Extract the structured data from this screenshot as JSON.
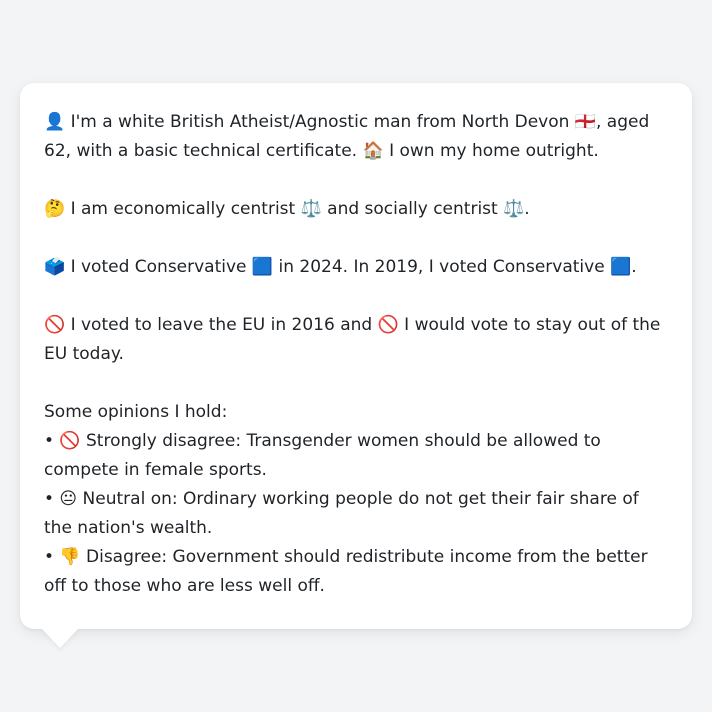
{
  "profile": {
    "line1": "👤 I'm a white British Atheist/Agnostic man from North Devon 🏴󠁧󠁢󠁥󠁮󠁧󠁿, aged 62, with a basic technical certificate. 🏠 I own my home outright.",
    "line2": "🤔 I am economically centrist ⚖️ and socially centrist ⚖️.",
    "line3": "🗳️ I voted Conservative 🟦 in 2024. In 2019, I voted Conservative 🟦.",
    "line4": "🚫 I voted to leave the EU in 2016 and 🚫 I would vote to stay out of the EU today.",
    "opinions_heading": "Some opinions I hold:",
    "opinions": [
      "• 🚫 Strongly disagree: Transgender women should be allowed to compete in female sports.",
      "• 😐 Neutral on: Ordinary working people do not get their fair share of the nation's wealth.",
      "• 👎 Disagree: Government should redistribute income from the better off to those who are less well off."
    ]
  }
}
